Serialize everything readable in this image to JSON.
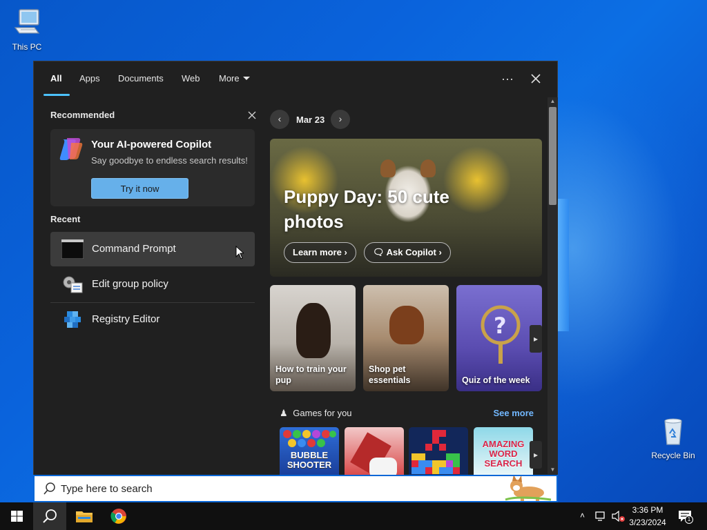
{
  "desktop": {
    "icons": [
      {
        "label": "This PC"
      },
      {
        "label": "Recycle Bin"
      }
    ]
  },
  "tabs": [
    {
      "label": "All"
    },
    {
      "label": "Apps"
    },
    {
      "label": "Documents"
    },
    {
      "label": "Web"
    },
    {
      "label": "More"
    }
  ],
  "recommended": {
    "title": "Recommended",
    "card_title": "Your AI-powered Copilot",
    "card_subtitle": "Say goodbye to endless search results!",
    "button": "Try it now"
  },
  "recent": {
    "title": "Recent",
    "items": [
      {
        "label": "Command Prompt",
        "icon": "command-prompt-icon"
      },
      {
        "label": "Edit group policy",
        "icon": "group-policy-icon"
      },
      {
        "label": "Registry Editor",
        "icon": "registry-editor-icon"
      }
    ]
  },
  "highlights": {
    "date": "Mar 23",
    "hero_title": "Puppy Day: 50 cute photos",
    "learn_more": "Learn more",
    "ask_copilot": "Ask Copilot",
    "tiles": [
      {
        "caption": "How to train your pup"
      },
      {
        "caption": "Shop pet essentials"
      },
      {
        "caption": "Quiz of the week"
      }
    ],
    "games_title": "Games for you",
    "see_more": "See more",
    "games": [
      {
        "label": "BUBBLE SHOOTER"
      },
      {
        "label": ""
      },
      {
        "label": ""
      },
      {
        "label": "AMAZING WORD SEARCH"
      }
    ]
  },
  "search": {
    "placeholder": "Type here to search"
  },
  "taskbar": {
    "time": "3:36 PM",
    "date": "3/23/2024",
    "notification_count": "1"
  },
  "colors": {
    "accent": "#4cc2ff",
    "panel_bg": "#202020",
    "link": "#72b8ff",
    "try_button": "#66b0ea"
  }
}
